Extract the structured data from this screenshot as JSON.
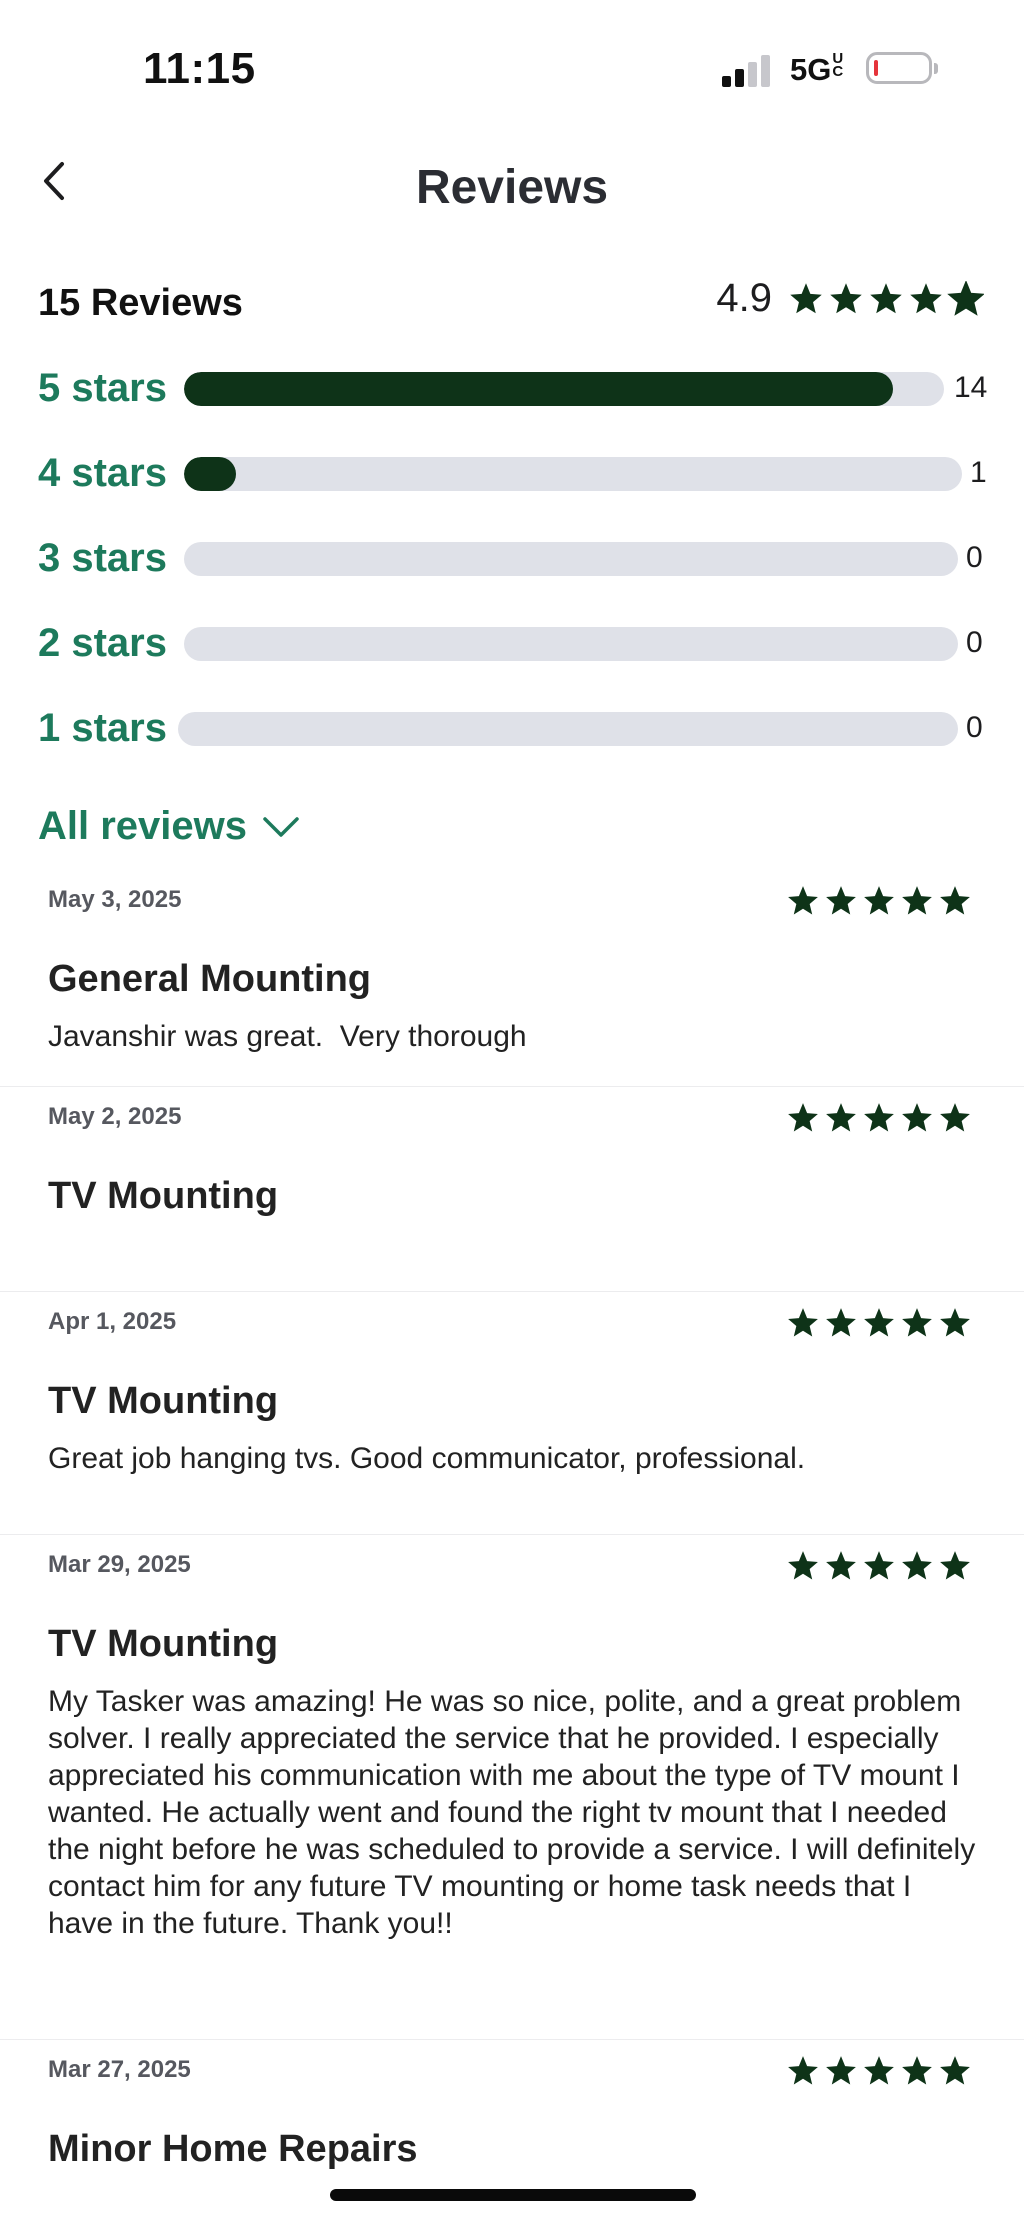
{
  "status_bar": {
    "time": "11:15",
    "network": "5G",
    "network_suffix": "UC"
  },
  "header": {
    "title": "Reviews",
    "back_icon": "chevron-left-icon"
  },
  "summary": {
    "count_label": "15 Reviews",
    "rating": "4.9",
    "rating_value": 4.9,
    "star_color": "#0e3318"
  },
  "distribution": [
    {
      "label": "5 stars",
      "count": "14",
      "fraction": 0.933
    },
    {
      "label": "4 stars",
      "count": "1",
      "fraction": 0.067
    },
    {
      "label": "3 stars",
      "count": "0",
      "fraction": 0
    },
    {
      "label": "2 stars",
      "count": "0",
      "fraction": 0
    },
    {
      "label": "1 stars",
      "count": "0",
      "fraction": 0
    }
  ],
  "filter": {
    "label": "All reviews",
    "icon": "chevron-down-icon"
  },
  "reviews": [
    {
      "date": "May 3, 2025",
      "rating": 5,
      "title": "General Mounting",
      "body": "Javanshir was great.  Very thorough"
    },
    {
      "date": "May 2, 2025",
      "rating": 5,
      "title": "TV Mounting",
      "body": ""
    },
    {
      "date": "Apr 1, 2025",
      "rating": 5,
      "title": "TV Mounting",
      "body": "Great job hanging tvs. Good communicator, professional."
    },
    {
      "date": "Mar 29, 2025",
      "rating": 5,
      "title": "TV Mounting",
      "body": "My Tasker was amazing! He was so nice, polite, and a great problem solver. I really appreciated the service that he provided. I especially appreciated his communication with me about the type of TV mount I wanted. He actually went and found the right tv mount that I needed the night before he was scheduled to provide a service. I will definitely contact him for any future TV mounting or home task needs that I have in the future. Thank you!!"
    },
    {
      "date": "Mar 27, 2025",
      "rating": 5,
      "title": "Minor Home Repairs",
      "body": ""
    }
  ],
  "colors": {
    "accent_green": "#1d7a5c",
    "dark_green": "#0e3318",
    "track_gray": "#dfe1e8"
  }
}
